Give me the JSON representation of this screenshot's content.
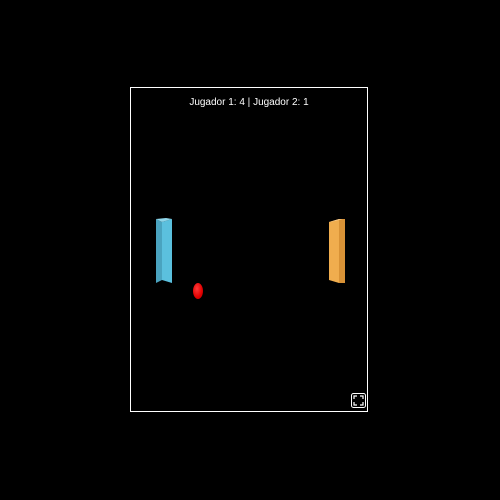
{
  "scoreboard": {
    "text": "Jugador 1: 4 | Jugador 2: 1"
  },
  "players": [
    {
      "name": "Jugador 1",
      "score": 4,
      "paddle_color": "#5bc0de"
    },
    {
      "name": "Jugador 2",
      "score": 1,
      "paddle_color": "#f0ad4e"
    }
  ],
  "ball": {
    "color": "#e00000"
  },
  "frame": {
    "border_color": "#ffffff",
    "background": "#000000"
  },
  "controls": {
    "fullscreen_icon": "fullscreen-icon"
  }
}
